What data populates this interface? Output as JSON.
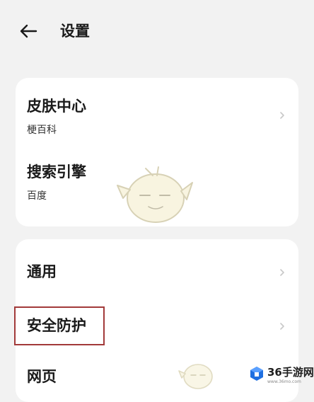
{
  "header": {
    "title": "设置",
    "back_icon": "back-arrow-icon"
  },
  "groups": [
    {
      "items": [
        {
          "title": "皮肤中心",
          "subtitle": "梗百科"
        },
        {
          "title": "搜索引擎",
          "subtitle": "百度"
        }
      ]
    },
    {
      "items": [
        {
          "title": "通用"
        },
        {
          "title": "安全防护",
          "highlighted": true
        },
        {
          "title": "网页"
        }
      ]
    }
  ],
  "watermark": {
    "text": "36手游网",
    "subtext": "www.36mo.com"
  },
  "colors": {
    "background": "#f2f2f2",
    "card": "#ffffff",
    "highlight_border": "#a23a3a",
    "watermark_blue": "#1f6fe0"
  }
}
